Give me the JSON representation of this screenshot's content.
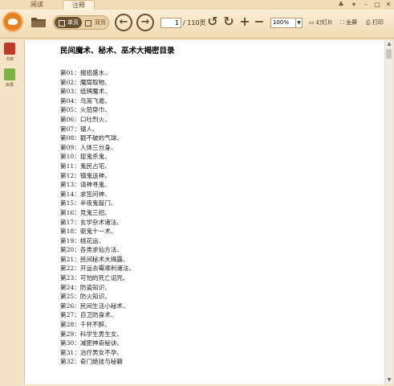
{
  "tabs": {
    "read": "阅读",
    "notes": "注释"
  },
  "toolbar": {
    "single_page": "单页",
    "double_page": "双页",
    "page_current": "1",
    "page_total": "/ 110页",
    "zoom": "100%",
    "slideshow": "幻灯片",
    "fullscreen": "全屏",
    "print": "打印"
  },
  "sidebar": {
    "bookshelf": "书架",
    "toc": "目录"
  },
  "colors": {
    "toolbar_bg": "#f0d9b0",
    "accent": "#e67e22",
    "icon": "#6a4f2e"
  },
  "document": {
    "title": "民间魔术、秘术、巫术大揭密目录",
    "toc": [
      "第01：报纸盛水、",
      "第02：魔筒取物、",
      "第03：纸牌魔术、",
      "第04：鸟笼飞遁、",
      "第05：火茄穿巾、",
      "第06：口吐烈火、",
      "第07：锯人、",
      "第08：戳不破的气球、",
      "第09：人体三分身、",
      "第10：捉鬼杀鬼、",
      "第11：鬼民占宅、",
      "第12：镇鬼送神、",
      "第13：请神寻鬼、",
      "第14：求签问神、",
      "第15：半夜鬼敲门、",
      "第16：見鬼三招、",
      "第17：玄学杂术诸法、",
      "第18：驱鬼十一术、",
      "第19：桃花运、",
      "第20：各类求仙方法、",
      "第21：民间秘术大揭露、",
      "第22：开运去霉顺利诸法、",
      "第23：可怕的死亡诅咒、",
      "第24：防盗知识、",
      "第25：防火知识、",
      "第26：民间生活小秘术、",
      "第27：自卫防身术、",
      "第28：千杯不醉、",
      "第29：科学生男生女、",
      "第30：减肥神奇秘诀、",
      "第31：治疗男女不孕、",
      "第32：奇门绝技与秘籍"
    ]
  }
}
